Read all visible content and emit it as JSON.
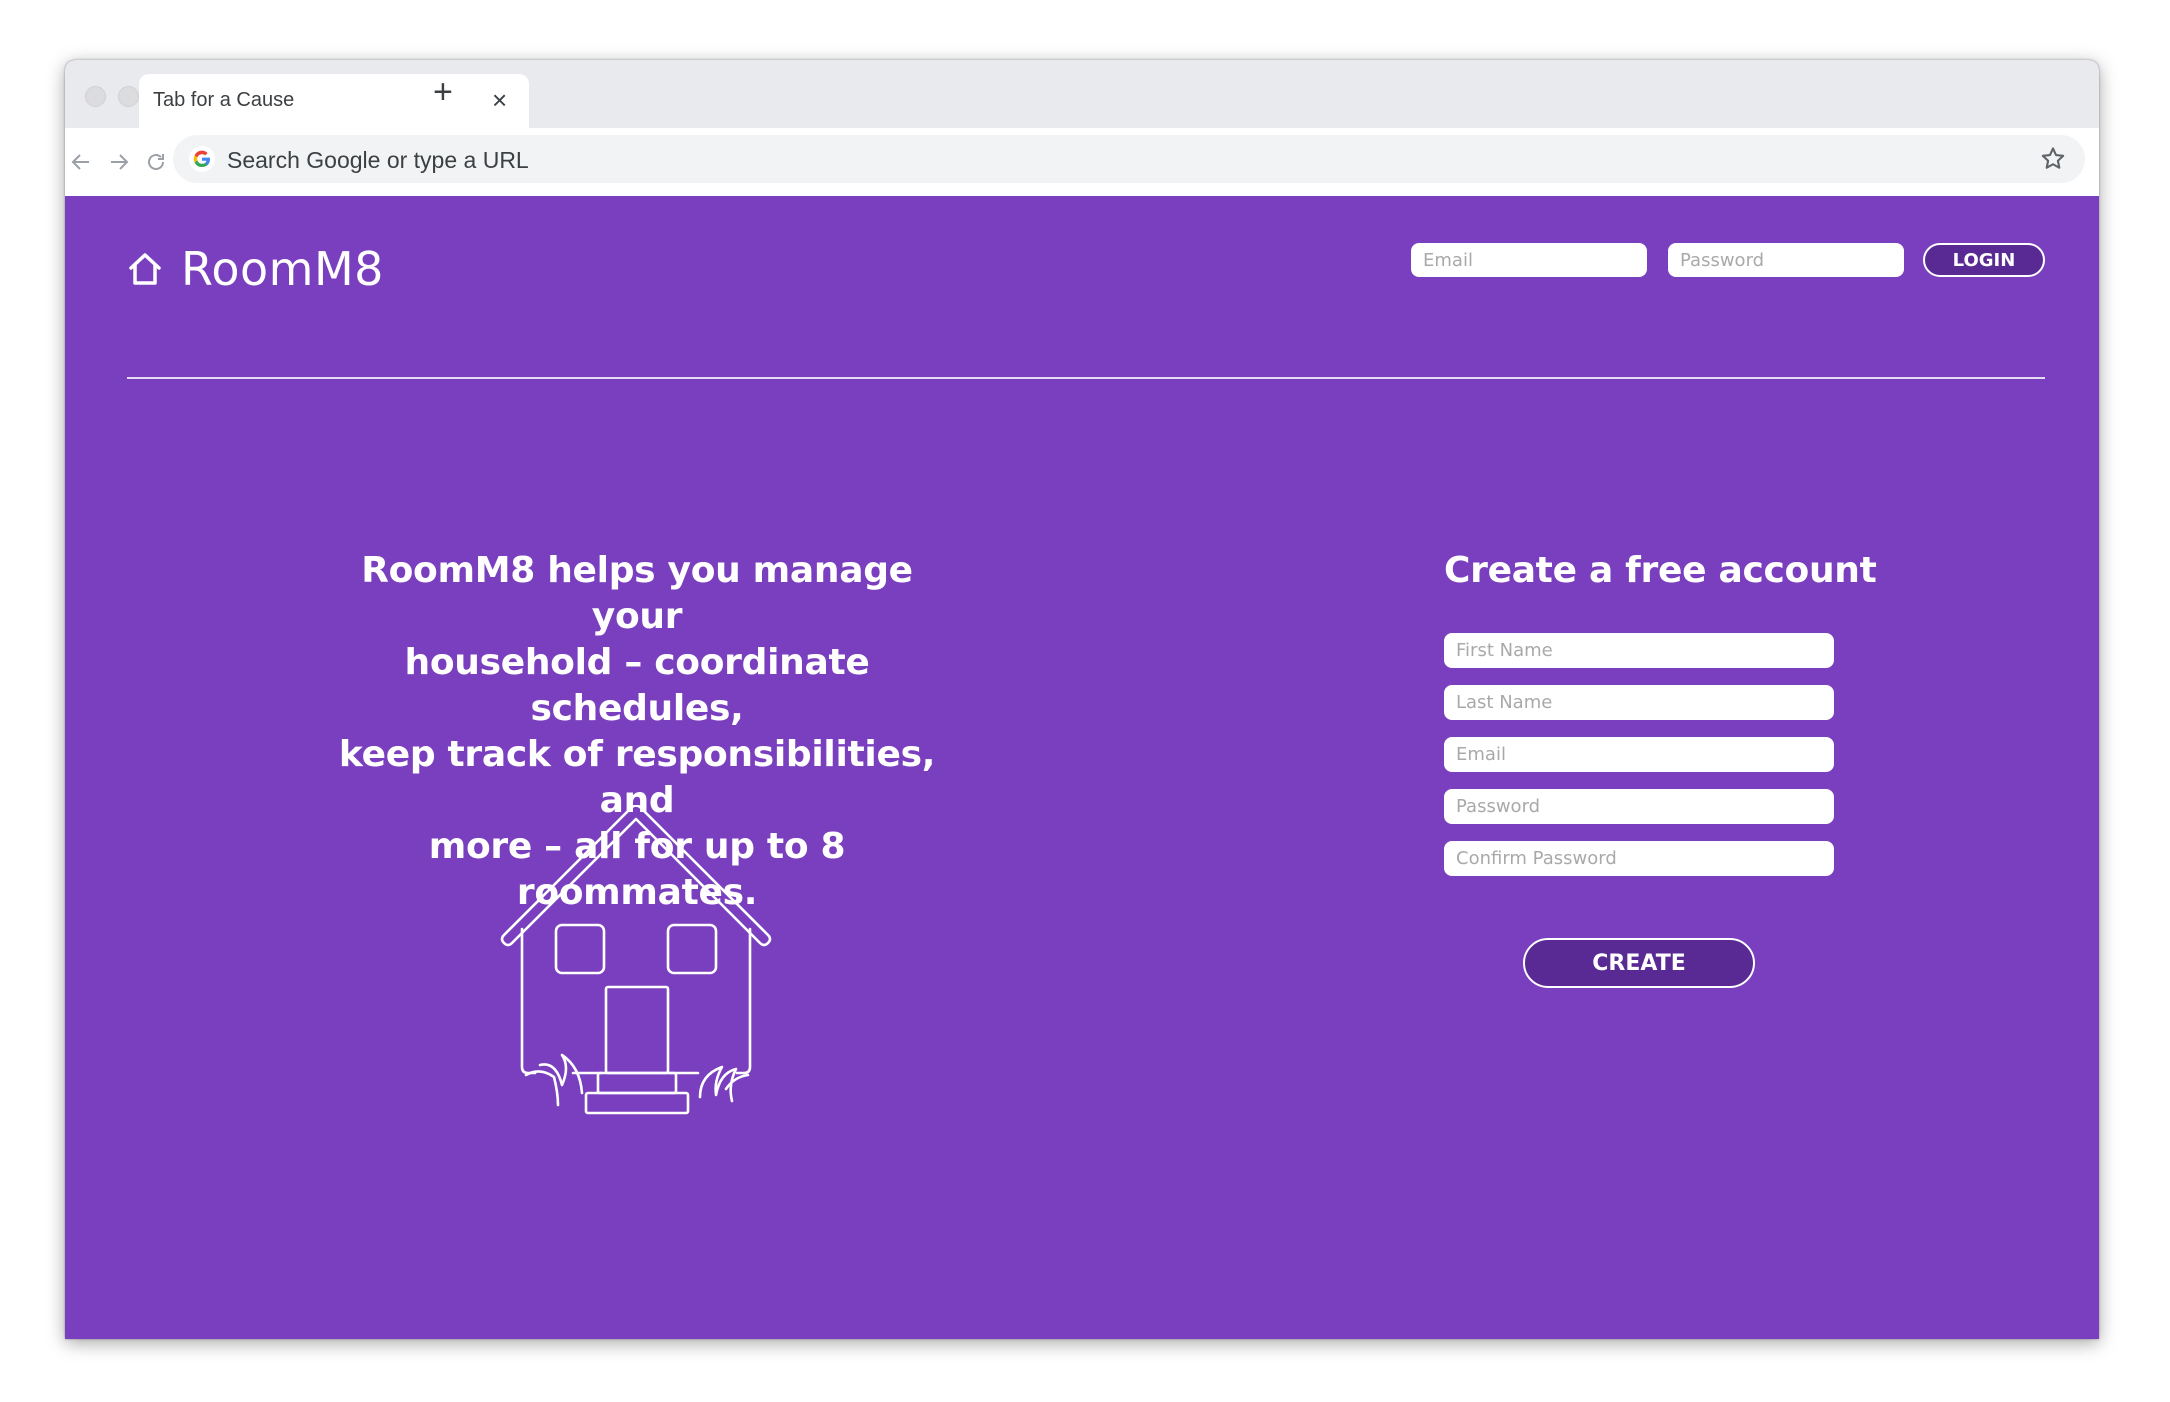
{
  "browser": {
    "tab": {
      "title": "Tab for a Cause",
      "close_icon": "close-icon"
    },
    "new_tab_icon": "plus-icon",
    "nav": {
      "back_icon": "arrow-left-icon",
      "forward_icon": "arrow-right-icon",
      "reload_icon": "reload-icon"
    },
    "omnibox": {
      "placeholder": "Search Google or type a URL",
      "value": "",
      "engine_icon": "google-icon",
      "bookmark_icon": "star-icon"
    }
  },
  "header": {
    "logo_icon": "house-icon",
    "brand": "RoomM8",
    "login": {
      "email_placeholder": "Email",
      "password_placeholder": "Password",
      "button_label": "LOGIN"
    }
  },
  "hero": {
    "tagline_lines": [
      "RoomM8 helps you manage your",
      "household – coordinate schedules,",
      "keep track of responsibilities, and",
      "more – all for up to 8 roommates."
    ],
    "illustration": "house-illustration"
  },
  "signup": {
    "title": "Create a free account",
    "fields": [
      {
        "placeholder": "First Name",
        "value": ""
      },
      {
        "placeholder": "Last Name",
        "value": ""
      },
      {
        "placeholder": "Email",
        "value": ""
      },
      {
        "placeholder": "Password",
        "value": ""
      },
      {
        "placeholder": "Confirm Password",
        "value": ""
      }
    ],
    "button_label": "CREATE"
  },
  "colors": {
    "brand_purple": "#7a3fbf",
    "button_purple": "#5a2a94",
    "text_white": "#ffffff",
    "placeholder_gray": "#a9a9a9"
  }
}
